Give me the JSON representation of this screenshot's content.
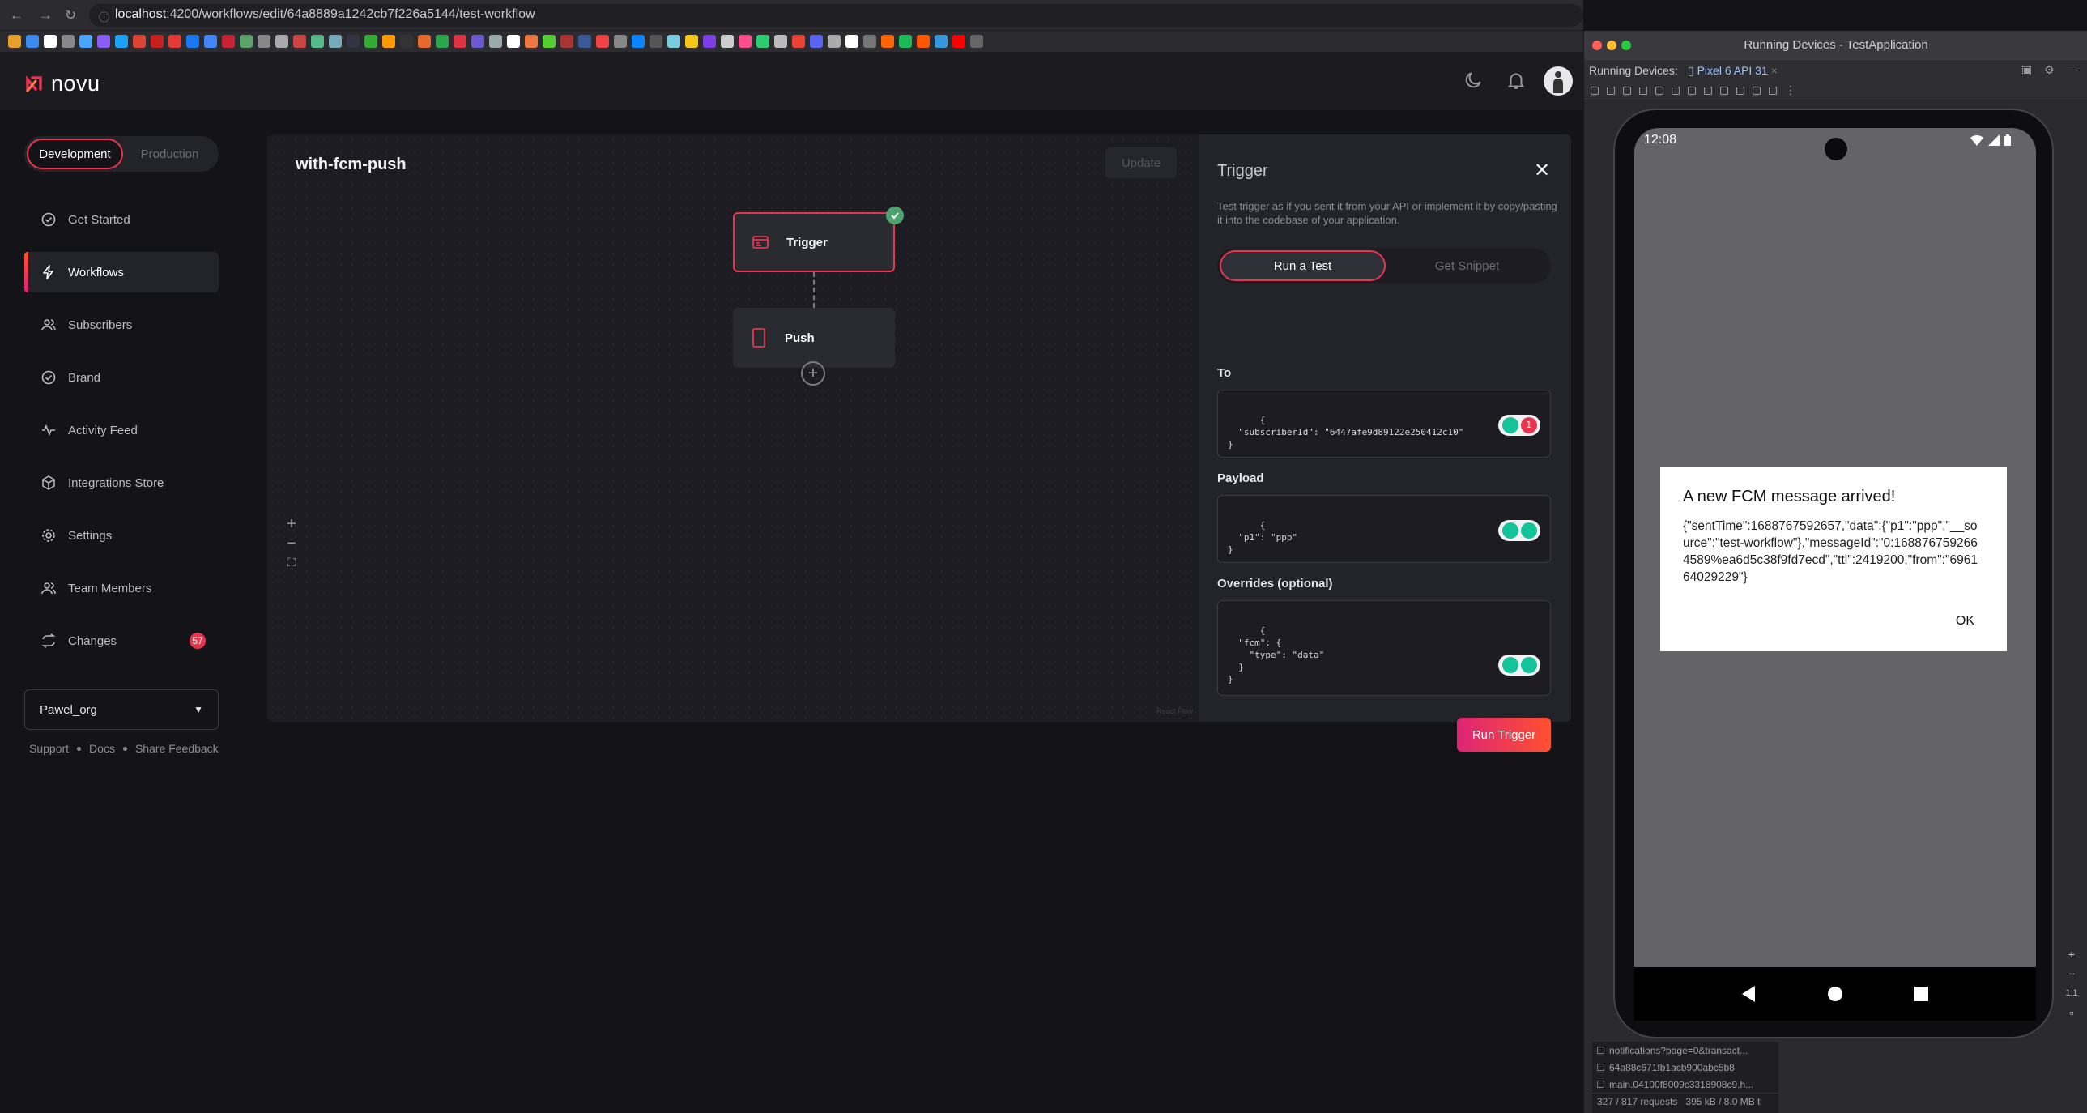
{
  "browser": {
    "url_host": "localhost",
    "url_path": ":4200/workflows/edit/64a8889a1242cb7f226a5144/test-workflow"
  },
  "bookmark_colors": [
    "#e8a02a",
    "#3b8cf0",
    "#ffffff",
    "#888",
    "#4aa3ff",
    "#8a5cf6",
    "#1da1f2",
    "#db4437",
    "#c5221f",
    "#e53935",
    "#1877f2",
    "#4285f4",
    "#c82333",
    "#5aa469",
    "#888",
    "#aaa",
    "#cc4444",
    "#5b8",
    "#7ab",
    "#334",
    "#3a3",
    "#f90",
    "#333",
    "#e66a2b",
    "#2da44e",
    "#dd3344",
    "#6a5acd",
    "#9aa",
    "#fff",
    "#e74",
    "#5c3",
    "#a33",
    "#3b5998",
    "#e44",
    "#888",
    "#0a84ff",
    "#555",
    "#7cd",
    "#f5c518",
    "#7b3fe4",
    "#ccc",
    "#ff4f8b",
    "#2ecc71",
    "#bbb",
    "#ea4335",
    "#5865f2",
    "#aaa",
    "#fff",
    "#777",
    "#ff6600",
    "#1db954",
    "#ff5700",
    "#3498db",
    "#ff0000",
    "#666"
  ],
  "app": {
    "logo_text": "novu",
    "env": {
      "dev": "Development",
      "prod": "Production"
    },
    "nav": [
      {
        "label": "Get Started",
        "icon": "check-circle-icon"
      },
      {
        "label": "Workflows",
        "icon": "bolt-icon"
      },
      {
        "label": "Subscribers",
        "icon": "users-icon"
      },
      {
        "label": "Brand",
        "icon": "badge-check-icon"
      },
      {
        "label": "Activity Feed",
        "icon": "activity-icon"
      },
      {
        "label": "Integrations Store",
        "icon": "box-icon"
      },
      {
        "label": "Settings",
        "icon": "gear-icon"
      },
      {
        "label": "Team Members",
        "icon": "team-icon"
      },
      {
        "label": "Changes",
        "icon": "repeat-icon"
      }
    ],
    "changes_count": "57",
    "org": "Pawel_org",
    "footer": {
      "support": "Support",
      "docs": "Docs",
      "feedback": "Share Feedback"
    }
  },
  "workflow": {
    "title": "with-fcm-push",
    "update_label": "Update",
    "nodes": {
      "trigger": "Trigger",
      "push": "Push"
    },
    "zoom_in": "+",
    "zoom_out": "−",
    "fit": "⛶",
    "attribution": "React Flow"
  },
  "trigger_panel": {
    "title": "Trigger",
    "description": "Test trigger as if you sent it from your API or implement it by copy/pasting it into the codebase of your application.",
    "tabs": {
      "run": "Run a Test",
      "snippet": "Get Snippet"
    },
    "to_label": "To",
    "to_code": "{\n  \"subscriberId\": \"6447afe9d89122e250412c10\"\n}",
    "to_badge": "1",
    "payload_label": "Payload",
    "payload_code": "{\n  \"p1\": \"ppp\"\n}",
    "overrides_label": "Overrides (optional)",
    "overrides_code": "{\n  \"fcm\": {\n    \"type\": \"data\"\n  }\n}",
    "run_button": "Run Trigger"
  },
  "emulator": {
    "window_title": "Running Devices - TestApplication",
    "devices_label": "Running Devices:",
    "device_tab": "Pixel 6 API 31",
    "time": "12:08",
    "dialog_title": "A new FCM message arrived!",
    "dialog_body": "{\"sentTime\":1688767592657,\"data\":{\"p1\":\"ppp\",\"__source\":\"test-workflow\"},\"messageId\":\"0:1688767592664589%ea6d5c38f9fd7ecd\",\"ttl\":2419200,\"from\":\"696164029229\"}",
    "dialog_ok": "OK",
    "zoom_ratio": "1:1",
    "net_rows": [
      "notifications?page=0&transact...",
      "64a88c671fb1acb900abc5b8",
      "main.04100f8009c3318908c9.h..."
    ],
    "net_summary": "327 / 817 requests   395 kB / 8.0 MB t"
  }
}
